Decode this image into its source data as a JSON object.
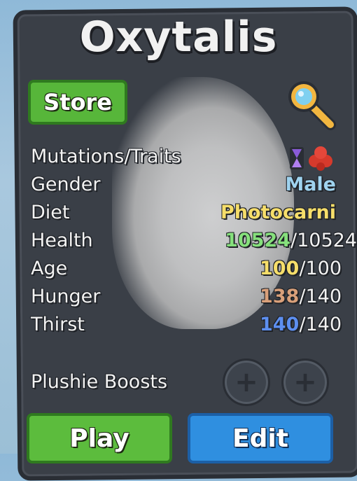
{
  "creature": {
    "name": "Oxytalis"
  },
  "buttons": {
    "store": "Store",
    "play": "Play",
    "edit": "Edit"
  },
  "stats": {
    "mutations_label": "Mutations/Traits",
    "gender_label": "Gender",
    "gender_value": "Male",
    "diet_label": "Diet",
    "diet_value": "Photocarni",
    "health_label": "Health",
    "health_current": "10524",
    "health_max": "/10524",
    "age_label": "Age",
    "age_current": "100",
    "age_max": "/100",
    "hunger_label": "Hunger",
    "hunger_current": "138",
    "hunger_max": "/140",
    "thirst_label": "Thirst",
    "thirst_current": "140",
    "thirst_max": "/140"
  },
  "plushie": {
    "label": "Plushie Boosts",
    "slot_symbol": "+"
  },
  "colors": {
    "gender": "#9fd3ef",
    "diet": "#f6de6a",
    "health": "#86e07c",
    "age": "#f6de6a",
    "hunger": "#d9a07a",
    "thirst": "#5d8ff0"
  },
  "icons": {
    "magnifier": "magnifier-icon",
    "trait_hourglass": "hourglass-icon",
    "trait_cluster": "red-cluster-icon"
  }
}
